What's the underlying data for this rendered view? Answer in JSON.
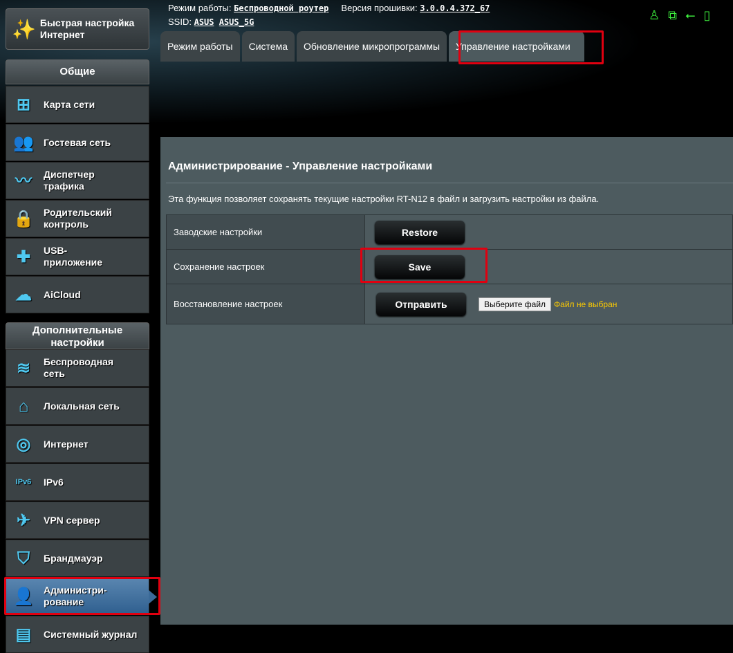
{
  "header": {
    "mode_label": "Режим работы:",
    "mode_value": "Беспроводной роутер",
    "fw_label": "Версия прошивки:",
    "fw_value": "3.0.0.4.372_67",
    "ssid_label": "SSID:",
    "ssid_1": "ASUS",
    "ssid_2": "ASUS_5G"
  },
  "tabs": [
    "Режим работы",
    "Система",
    "Обновление микропрограммы",
    "Управление настройками"
  ],
  "sidebar": {
    "quick_setup": "Быстрая настройка Интернет",
    "general_header": "Общие",
    "general": [
      {
        "label": "Карта сети",
        "icon": "network-map-icon"
      },
      {
        "label": "Гостевая сеть",
        "icon": "guest-network-icon"
      },
      {
        "label": "Диспетчер трафика",
        "icon": "traffic-manager-icon"
      },
      {
        "label": "Родительский контроль",
        "icon": "lock-icon"
      },
      {
        "label": "USB-приложение",
        "icon": "puzzle-icon"
      },
      {
        "label": "AiCloud",
        "icon": "cloud-icon"
      }
    ],
    "advanced_header": "Дополнительные настройки",
    "advanced": [
      {
        "label": "Беспроводная сеть",
        "icon": "wifi-icon"
      },
      {
        "label": "Локальная сеть",
        "icon": "home-icon"
      },
      {
        "label": "Интернет",
        "icon": "globe-icon"
      },
      {
        "label": "IPv6",
        "icon": "ipv6-icon"
      },
      {
        "label": "VPN сервер",
        "icon": "vpn-icon"
      },
      {
        "label": "Брандмауэр",
        "icon": "shield-icon"
      },
      {
        "label": "Администри-рование",
        "icon": "user-icon"
      },
      {
        "label": "Системный журнал",
        "icon": "log-icon"
      }
    ]
  },
  "main": {
    "title": "Администрирование - Управление настройками",
    "description": "Эта функция позволяет сохранять текущие настройки RT-N12 в файл и загрузить настройки из файла.",
    "rows": [
      {
        "label": "Заводские настройки",
        "button": "Restore"
      },
      {
        "label": "Сохранение настроек",
        "button": "Save"
      },
      {
        "label": "Восстановление настроек",
        "button": "Отправить"
      }
    ],
    "file_button": "Выберите файл",
    "file_status": "Файл не выбран"
  },
  "colors": {
    "highlight": "#e00010",
    "status_green": "#3ef03e",
    "accent": "#4fc8f0"
  }
}
